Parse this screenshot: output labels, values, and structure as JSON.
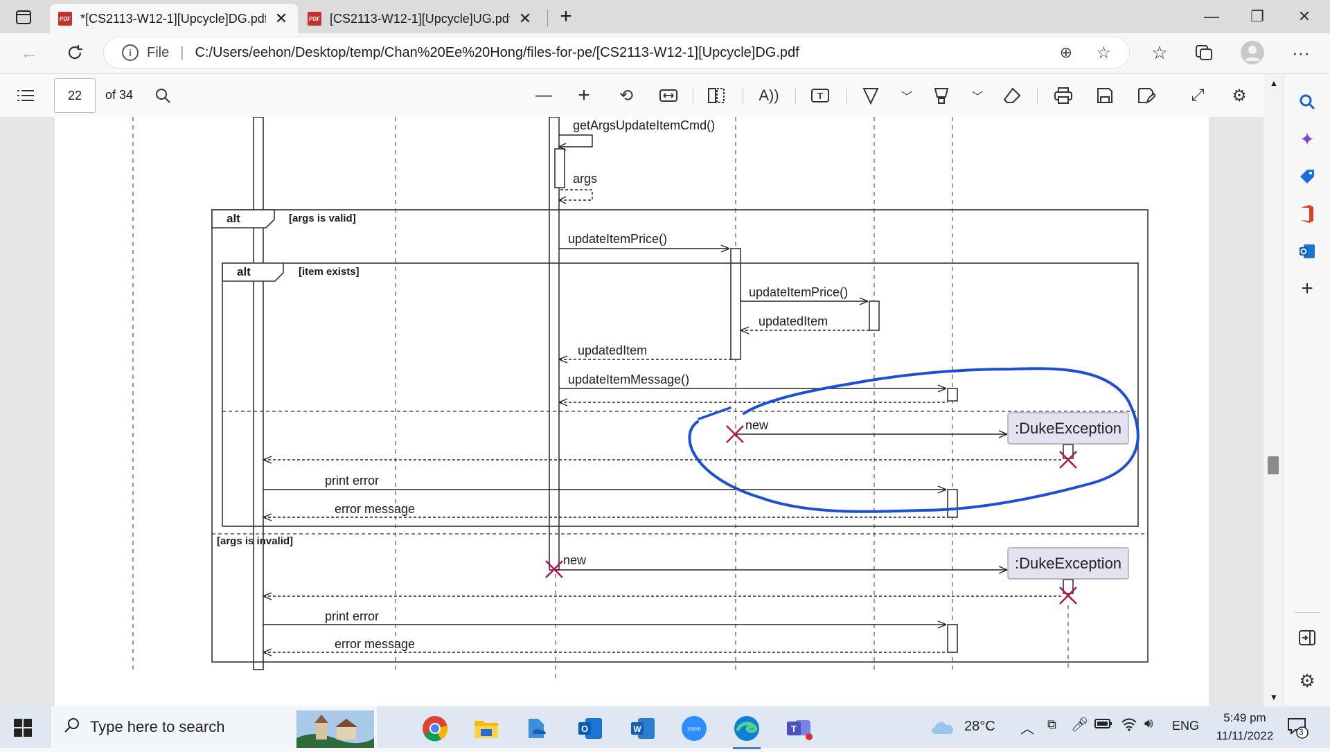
{
  "tabs": [
    {
      "title": "*[CS2113-W12-1][Upcycle]DG.pdf",
      "active": true,
      "icon": "pdf-icon"
    },
    {
      "title": "[CS2113-W12-1][Upcycle]UG.pdf",
      "active": false,
      "icon": "pdf-icon"
    }
  ],
  "window": {
    "minimize": "—",
    "restore": "❐",
    "close": "✕"
  },
  "address": {
    "scheme_label": "File",
    "url": "C:/Users/eehon/Desktop/temp/Chan%20Ee%20Hong/files-for-pe/[CS2113-W12-1][Upcycle]DG.pdf"
  },
  "pdf_toolbar": {
    "page_number": "22",
    "page_count": "of 34"
  },
  "diagram": {
    "messages": {
      "get_args": "getArgsUpdateItemCmd()",
      "args": "args",
      "update_price_1": "updateItemPrice()",
      "update_price_2": "updateItemPrice()",
      "updated_item_1": "updatedItem",
      "updated_item_2": "updatedItem",
      "update_message": "updateItemMessage()",
      "new_1": "new",
      "new_2": "new",
      "print_error_1": "print error",
      "error_message_1": "error message",
      "print_error_2": "print error",
      "error_message_2": "error message"
    },
    "frames": {
      "outer_label": "alt",
      "outer_guard": "[args is valid]",
      "inner_label": "alt",
      "inner_guard": "[item exists]",
      "else_guard": "[args is invalid]"
    },
    "participants": {
      "exception_1": ":DukeException",
      "exception_2": ":DukeException"
    },
    "colors": {
      "annotation": "#1a4fd6",
      "destroy": "#b3124f",
      "participant_fill": "#e2e2f0"
    }
  },
  "taskbar": {
    "search_placeholder": "Type here to search",
    "weather": "28°C",
    "language": "ENG",
    "time": "5:49 pm",
    "date": "11/11/2022",
    "notifications": "3"
  }
}
